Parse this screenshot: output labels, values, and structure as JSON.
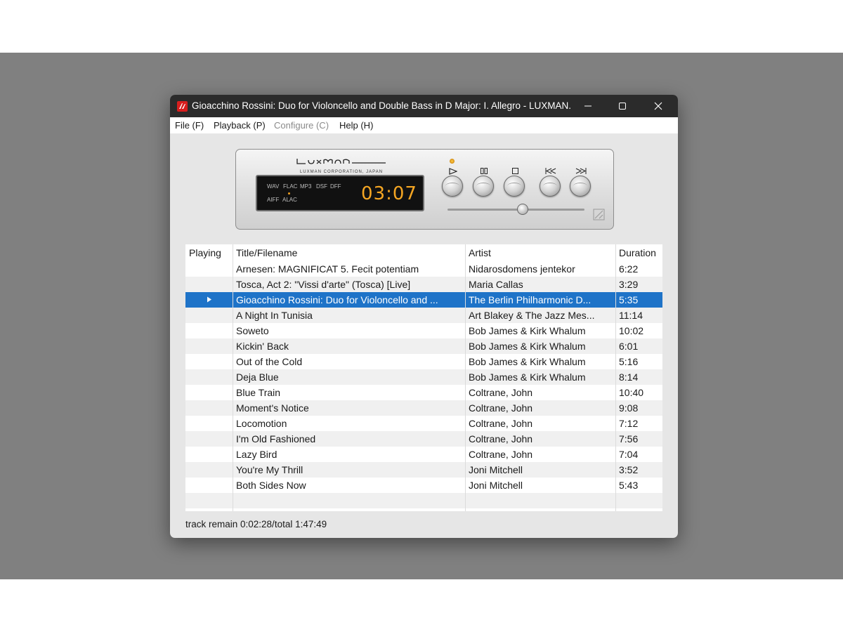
{
  "window": {
    "title": "Gioacchino Rossini: Duo for Violoncello and Double Bass in D Major: I. Allegro - LUXMAN..."
  },
  "menu": [
    {
      "label": "File (F)",
      "enabled": true
    },
    {
      "label": "Playback (P)",
      "enabled": true
    },
    {
      "label": "Configure (C)",
      "enabled": false
    },
    {
      "label": "Help (H)",
      "enabled": true
    }
  ],
  "player": {
    "brand": "Luxman",
    "brand_sub": "LUXMAN CORPORATION, JAPAN",
    "formats_row1": [
      "WAV",
      "FLAC",
      "MP3",
      "DSF",
      "DFF"
    ],
    "formats_row2": [
      "AIFF",
      "ALAC"
    ],
    "active_format": "FLAC",
    "time": "03:07",
    "controls": [
      "play",
      "pause",
      "stop",
      "previous",
      "next"
    ],
    "volume_level": 0.55
  },
  "playlist": {
    "columns": [
      "Playing",
      "Title/Filename",
      "Artist",
      "Duration"
    ],
    "rows": [
      {
        "playing": false,
        "title": "Arnesen: MAGNIFICAT 5. Fecit potentiam",
        "artist": "Nidarosdomens jentekor",
        "duration": "6:22"
      },
      {
        "playing": false,
        "title": "Tosca, Act 2: \"Vissi d'arte\" (Tosca) [Live]",
        "artist": "Maria Callas",
        "duration": "3:29"
      },
      {
        "playing": true,
        "title": "Gioacchino Rossini: Duo for Violoncello and ...",
        "artist": "The Berlin Philharmonic D...",
        "duration": "5:35"
      },
      {
        "playing": false,
        "title": "A Night In Tunisia",
        "artist": "Art Blakey & The Jazz Mes...",
        "duration": "11:14"
      },
      {
        "playing": false,
        "title": "Soweto",
        "artist": "Bob James & Kirk Whalum",
        "duration": "10:02"
      },
      {
        "playing": false,
        "title": "Kickin' Back",
        "artist": "Bob James & Kirk Whalum",
        "duration": "6:01"
      },
      {
        "playing": false,
        "title": "Out of the Cold",
        "artist": "Bob James & Kirk Whalum",
        "duration": "5:16"
      },
      {
        "playing": false,
        "title": "Deja Blue",
        "artist": "Bob James & Kirk Whalum",
        "duration": "8:14"
      },
      {
        "playing": false,
        "title": "Blue Train",
        "artist": "Coltrane, John",
        "duration": "10:40"
      },
      {
        "playing": false,
        "title": "Moment's Notice",
        "artist": "Coltrane, John",
        "duration": "9:08"
      },
      {
        "playing": false,
        "title": "Locomotion",
        "artist": "Coltrane, John",
        "duration": "7:12"
      },
      {
        "playing": false,
        "title": "I'm Old Fashioned",
        "artist": "Coltrane, John",
        "duration": "7:56"
      },
      {
        "playing": false,
        "title": "Lazy Bird",
        "artist": "Coltrane, John",
        "duration": "7:04"
      },
      {
        "playing": false,
        "title": "You're My Thrill",
        "artist": "Joni Mitchell",
        "duration": "3:52"
      },
      {
        "playing": false,
        "title": "Both Sides Now",
        "artist": "Joni Mitchell",
        "duration": "5:43"
      }
    ]
  },
  "status": "track remain 0:02:28/total 1:47:49",
  "colors": {
    "selection": "#1e73c8",
    "titlebar": "#2b2b2b",
    "display_digits": "#f5a623",
    "app_icon": "#d81e1e"
  }
}
